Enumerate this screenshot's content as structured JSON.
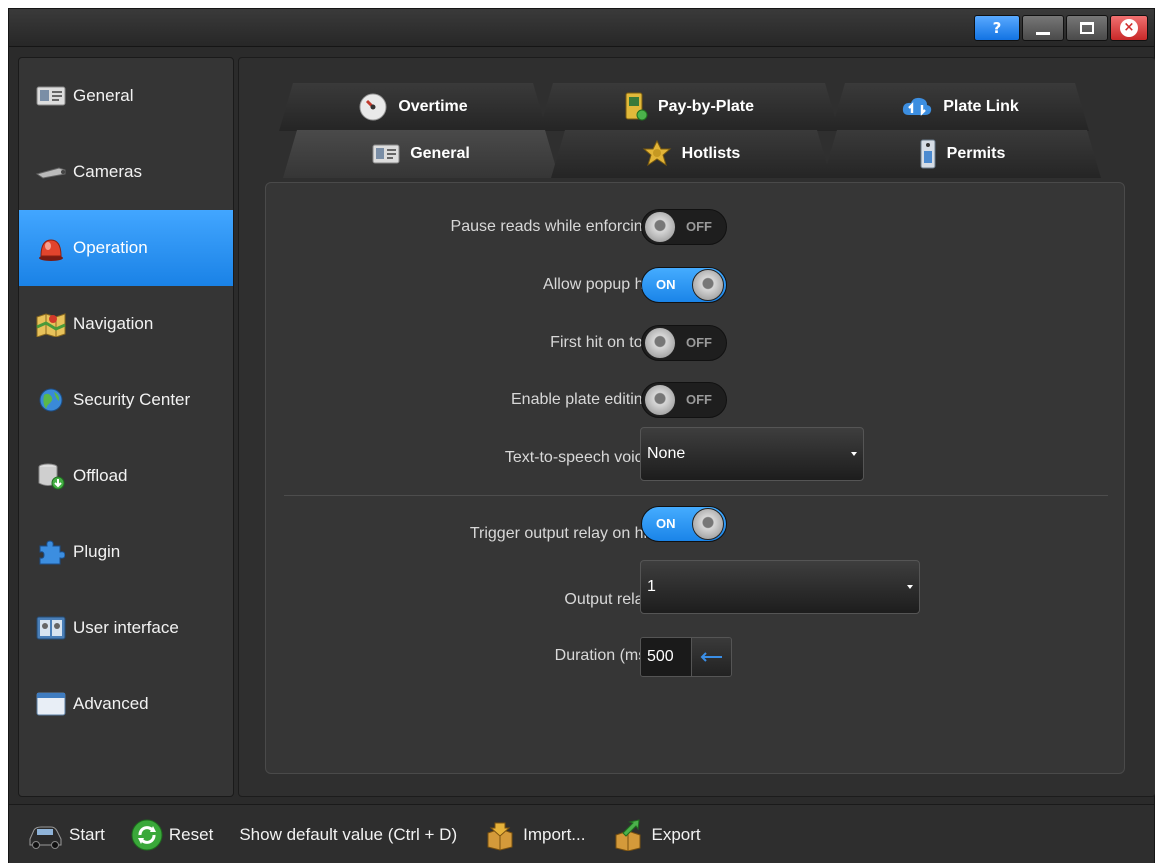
{
  "window": {
    "help_label": "?",
    "close_label": "×"
  },
  "sidebar": {
    "items": [
      {
        "label": "General"
      },
      {
        "label": "Cameras"
      },
      {
        "label": "Operation"
      },
      {
        "label": "Navigation"
      },
      {
        "label": "Security Center"
      },
      {
        "label": "Offload"
      },
      {
        "label": "Plugin"
      },
      {
        "label": "User interface"
      },
      {
        "label": "Advanced"
      }
    ]
  },
  "tabs": {
    "back_row": [
      {
        "label": "Overtime"
      },
      {
        "label": "Pay-by-Plate"
      },
      {
        "label": "Plate Link"
      }
    ],
    "front_row": [
      {
        "label": "General"
      },
      {
        "label": "Hotlists"
      },
      {
        "label": "Permits"
      }
    ]
  },
  "settings": {
    "pause_reads": {
      "label": "Pause reads while enforcing:",
      "state": "OFF"
    },
    "allow_popup": {
      "label": "Allow popup hit:",
      "state": "ON"
    },
    "first_hit": {
      "label": "First hit on top:",
      "state": "OFF"
    },
    "plate_editing": {
      "label": "Enable plate editing:",
      "state": "OFF"
    },
    "tts_voice": {
      "label": "Text-to-speech voice:",
      "value": "None"
    },
    "trigger_relay": {
      "label": "Trigger output relay on hit:",
      "state": "ON"
    },
    "output_relay": {
      "label": "Output relay:",
      "value": "1"
    },
    "duration": {
      "label": "Duration (ms):",
      "value": "500"
    }
  },
  "toolbar": {
    "start": "Start",
    "reset": "Reset",
    "show_default": "Show default value (Ctrl + D)",
    "import": "Import...",
    "export": "Export"
  },
  "colors": {
    "accent": "#1e88ec",
    "background": "#2b2b2b"
  }
}
